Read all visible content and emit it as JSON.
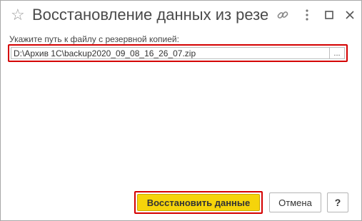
{
  "window": {
    "title": "Восстановление данных из резерв...",
    "icons": [
      "star-icon",
      "link-icon",
      "more-icon",
      "maximize-icon",
      "close-icon"
    ]
  },
  "form": {
    "path_label": "Укажите путь к файлу с резервной копией:",
    "path_value": "D:\\Архив 1С\\backup2020_09_08_16_26_07.zip",
    "browse_label": "..."
  },
  "buttons": {
    "restore_label": "Восстановить данные",
    "cancel_label": "Отмена",
    "help_label": "?"
  },
  "colors": {
    "accent_yellow": "#f5d40b",
    "highlight_red": "#d40000"
  }
}
